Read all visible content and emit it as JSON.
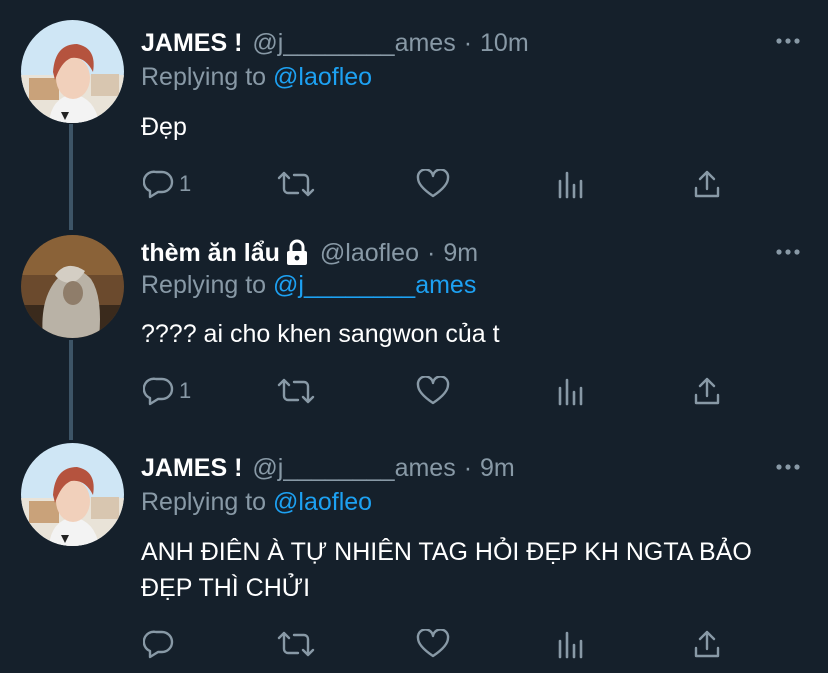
{
  "tweets": [
    {
      "display_name": "JAMES !",
      "handle": "@j________ames",
      "separator": "·",
      "time": "10m",
      "replying_prefix": "Replying to",
      "replying_to": "@laofleo",
      "text": "Đẹp",
      "reply_count": "1",
      "retweet_count": "",
      "like_count": "",
      "protected": false,
      "avatar": "person-red-hair-avatar"
    },
    {
      "display_name": "thèm ăn lẩu",
      "handle": "@laofleo",
      "separator": "·",
      "time": "9m",
      "replying_prefix": "Replying to",
      "replying_to": "@j________ames",
      "text": "???? ai cho khen sangwon của t",
      "reply_count": "1",
      "retweet_count": "",
      "like_count": "",
      "protected": true,
      "avatar": "person-hoodie-avatar"
    },
    {
      "display_name": "JAMES !",
      "handle": "@j________ames",
      "separator": "·",
      "time": "9m",
      "replying_prefix": "Replying to",
      "replying_to": "@laofleo",
      "text": "ANH ĐIÊN À TỰ NHIÊN TAG HỎI ĐẸP KH NGTA BẢO ĐẸP THÌ CHỬI",
      "reply_count": "",
      "retweet_count": "",
      "like_count": "",
      "protected": false,
      "avatar": "person-red-hair-avatar"
    }
  ],
  "colors": {
    "background": "#15202b",
    "text": "#ffffff",
    "secondary": "#8899a6",
    "accent": "#1da1f2",
    "thread_line": "#3d5466"
  }
}
